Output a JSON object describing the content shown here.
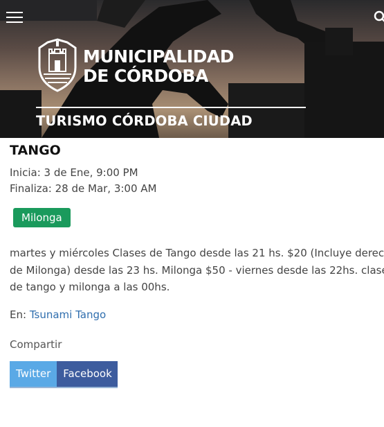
{
  "header": {
    "brand_line1": "MUNICIPALIDAD",
    "brand_line2": "DE CÓRDOBA",
    "section_title": "TURISMO CÓRDOBA CIUDAD",
    "menu_icon": "hamburger-menu-icon",
    "search_icon": "search-icon",
    "logo": "municipal-crest-logo"
  },
  "event": {
    "title": "TANGO",
    "start": "Inicia: 3 de Ene, 9:00 PM",
    "end": "Finaliza: 28 de Mar, 3:00 AM",
    "category": "Milonga",
    "description": "martes y miércoles Clases de Tango desde las 21 hs. $20 (Incluye derecho de Milonga) desde las 23 hs. Milonga $50 - viernes desde las 22hs. clases de tango y milonga a las 00hs.",
    "venue_prefix": "En:",
    "venue_name": "Tsunami Tango"
  },
  "share": {
    "label": "Compartir",
    "twitter": "Twitter",
    "facebook": "Facebook"
  },
  "colors": {
    "tag": "#1a9a5c",
    "link": "#2f6eae",
    "twitter": "#5aa9e6",
    "facebook": "#3d5c9e"
  }
}
